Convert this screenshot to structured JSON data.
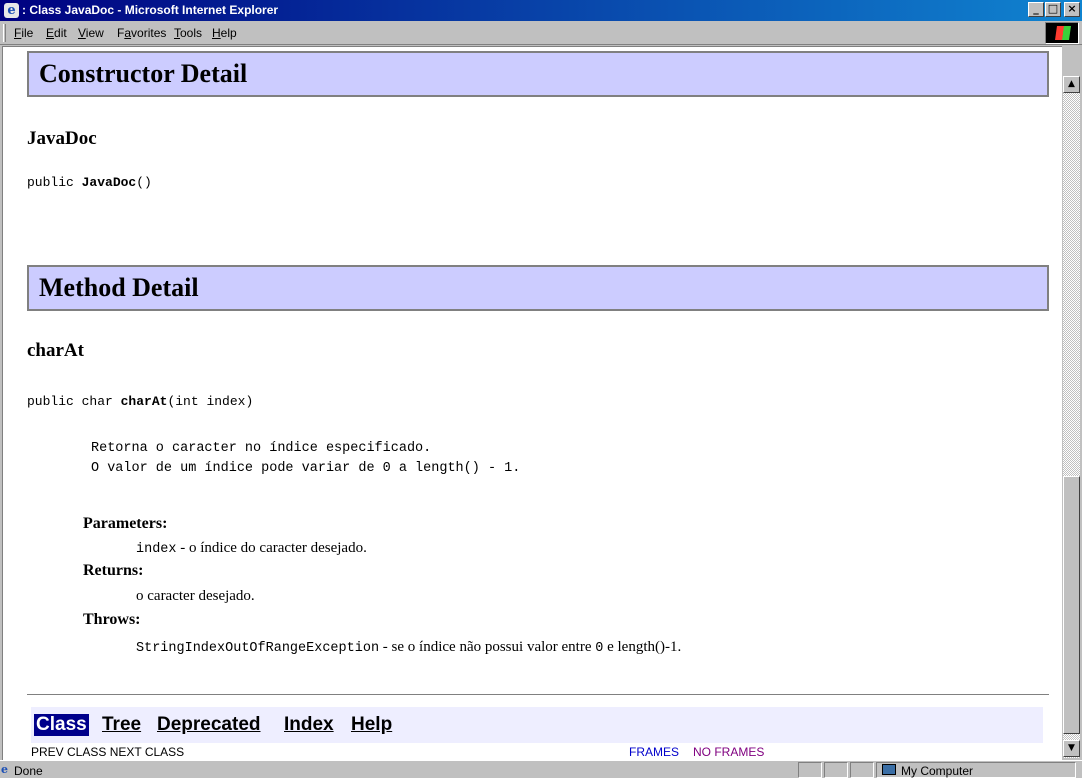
{
  "window": {
    "title": ": Class JavaDoc - Microsoft Internet Explorer",
    "icon": "ie-icon",
    "minimize": "_",
    "maximize": "□",
    "close": "×"
  },
  "menu": {
    "items": [
      {
        "label_u": "F",
        "label_rest": "ile"
      },
      {
        "label_u": "E",
        "label_rest": "dit"
      },
      {
        "label_u": "V",
        "label_rest": "iew"
      },
      {
        "label_pre": "F",
        "label_u": "a",
        "label_rest": "vorites"
      },
      {
        "label_u": "T",
        "label_rest": "ools"
      },
      {
        "label_u": "H",
        "label_rest": "elp"
      }
    ]
  },
  "doc": {
    "constructor_heading": "Constructor Detail",
    "constructor_name": "JavaDoc",
    "constructor_sig_pre": "public ",
    "constructor_sig_name": "JavaDoc",
    "constructor_sig_post": "()",
    "method_heading": "Method Detail",
    "method_name": "charAt",
    "method_sig_pre": "public char ",
    "method_sig_name": "charAt",
    "method_sig_post": "(int index)",
    "description_line1": "Retorna o caracter no índice especificado.",
    "description_line2": "O valor de um índice pode variar de 0 a length() - 1.",
    "params_label": "Parameters:",
    "param_code": "index",
    "param_text": " - o índice do caracter desejado.",
    "returns_label": "Returns:",
    "returns_text": "o caracter desejado.",
    "throws_label": "Throws:",
    "throws_code": "StringIndexOutOfRangeException",
    "throws_text_1": " - se o índice não possui valor entre ",
    "throws_code_2": "0",
    "throws_text_2": " e length()-1."
  },
  "navbar": {
    "items": [
      "Class",
      "Tree",
      "Deprecated",
      "Index",
      "Help"
    ],
    "active": "Class",
    "prev_next": "PREV CLASS   NEXT CLASS",
    "frames": "FRAMES",
    "no_frames": "NO FRAMES"
  },
  "statusbar": {
    "status": "Done",
    "zone": "My Computer"
  },
  "colors": {
    "heading_bg": "#ccccff",
    "navbar_bg": "#eeeeff",
    "active_nav": "#00008b",
    "titlebar": "#000080"
  }
}
